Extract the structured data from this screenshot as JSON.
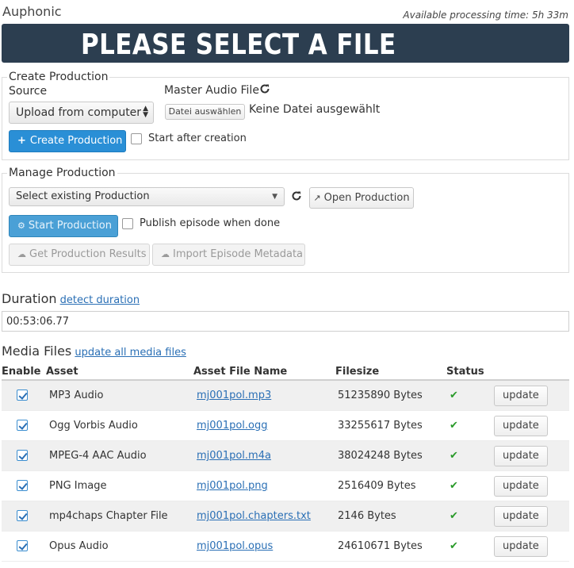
{
  "app": {
    "title": "Auphonic",
    "processing_time": "Available processing time: 5h 33m"
  },
  "banner": {
    "text": "PLEASE SELECT A FILE"
  },
  "create": {
    "legend": "Create Production",
    "source_label": "Source",
    "source_value": "Upload from computer",
    "master_label": "Master Audio File",
    "choose_file_label": "Datei auswählen",
    "no_file_text": "Keine Datei ausgewählt",
    "create_button": "Create Production",
    "start_after_label": "Start after creation"
  },
  "manage": {
    "legend": "Manage Production",
    "select_value": "Select existing Production",
    "open_button": "Open Production",
    "start_button": "Start Production",
    "publish_label": "Publish episode when done",
    "results_button": "Get Production Results",
    "import_button": "Import Episode Metadata"
  },
  "duration": {
    "label": "Duration",
    "link": "detect duration",
    "value": "00:53:06.77"
  },
  "media": {
    "label": "Media Files",
    "link": "update all media files",
    "columns": [
      "Enable",
      "Asset",
      "Asset File Name",
      "Filesize",
      "Status"
    ],
    "update_label": "update",
    "rows": [
      {
        "asset": "MP3 Audio",
        "file": "mj001pol.mp3",
        "size": "51235890 Bytes",
        "enabled": true
      },
      {
        "asset": "Ogg Vorbis Audio",
        "file": "mj001pol.ogg",
        "size": "33255617 Bytes",
        "enabled": true
      },
      {
        "asset": "MPEG-4 AAC Audio",
        "file": "mj001pol.m4a",
        "size": "38024248 Bytes",
        "enabled": true
      },
      {
        "asset": "PNG Image",
        "file": "mj001pol.png",
        "size": "2516409 Bytes",
        "enabled": true
      },
      {
        "asset": "mp4chaps Chapter File",
        "file": "mj001pol.chapters.txt",
        "size": "2146 Bytes",
        "enabled": true
      },
      {
        "asset": "Opus Audio",
        "file": "mj001pol.opus",
        "size": "24610671 Bytes",
        "enabled": true
      }
    ]
  },
  "icons": {
    "refresh": "refresh-icon",
    "plus": "plus-icon",
    "open": "open-external-icon",
    "cogs": "cogs-icon",
    "cloud": "cloud-download-icon",
    "ok": "checkmark-icon"
  },
  "colors": {
    "banner_bg": "#2c3e50",
    "primary": "#2a8fd6",
    "link": "#2a6fb5",
    "ok": "#2a9a2a"
  }
}
